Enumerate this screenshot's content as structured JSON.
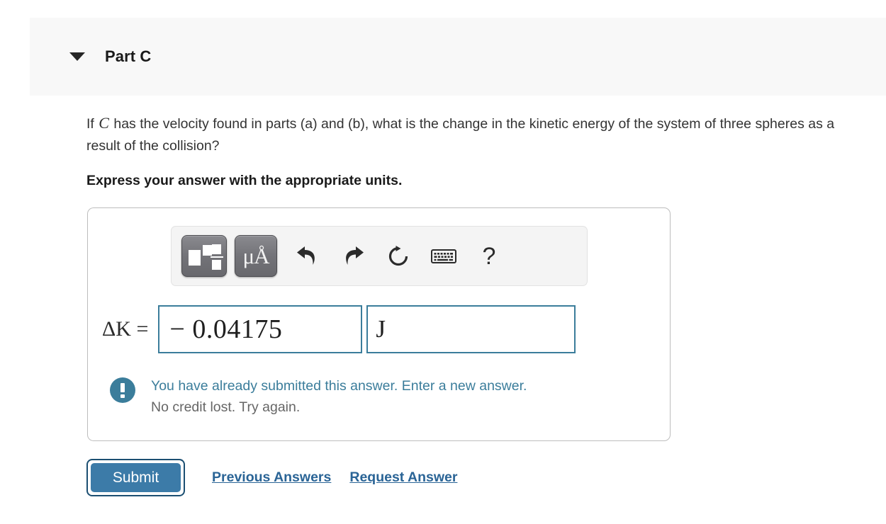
{
  "part": {
    "title": "Part C",
    "collapse_icon": "caret-down-icon",
    "expanded": true
  },
  "question": {
    "text_before_var": "If ",
    "variable": "C",
    "text_after_var": " has the velocity found in parts (a) and (b), what is the change in the kinetic energy of the system of three spheres as a result of the collision?",
    "instruction": "Express your answer with the appropriate units."
  },
  "toolbar": {
    "buttons": [
      {
        "name": "math-templates-button",
        "icon": "math-template-icon",
        "label": ""
      },
      {
        "name": "units-button",
        "icon": "micro-angstrom-icon",
        "label": "μÅ"
      },
      {
        "name": "undo-button",
        "icon": "undo-arrow-icon",
        "label": ""
      },
      {
        "name": "redo-button",
        "icon": "redo-arrow-icon",
        "label": ""
      },
      {
        "name": "reset-button",
        "icon": "reset-circular-arrow-icon",
        "label": ""
      },
      {
        "name": "keyboard-button",
        "icon": "keyboard-icon",
        "label": ""
      },
      {
        "name": "help-button",
        "icon": "question-mark-icon",
        "label": "?"
      }
    ]
  },
  "answer": {
    "label": "ΔK =",
    "value": "− 0.04175",
    "value_placeholder": "",
    "units": "J",
    "units_placeholder": ""
  },
  "feedback": {
    "icon": "exclamation-circle-icon",
    "primary": "You have already submitted this answer. Enter a new answer.",
    "secondary": "No credit lost. Try again.",
    "primary_color": "#3b7d9b",
    "secondary_color": "#666666"
  },
  "actions": {
    "submit_label": "Submit",
    "previous_answers_label": "Previous Answers",
    "request_answer_label": "Request Answer"
  },
  "colors": {
    "accent": "#3b7d9b",
    "link": "#2a6496",
    "submit_fill": "#3c7ba8",
    "submit_border": "#1b4f72",
    "header_band": "#f8f8f8",
    "input_border": "#3b7d9b"
  }
}
